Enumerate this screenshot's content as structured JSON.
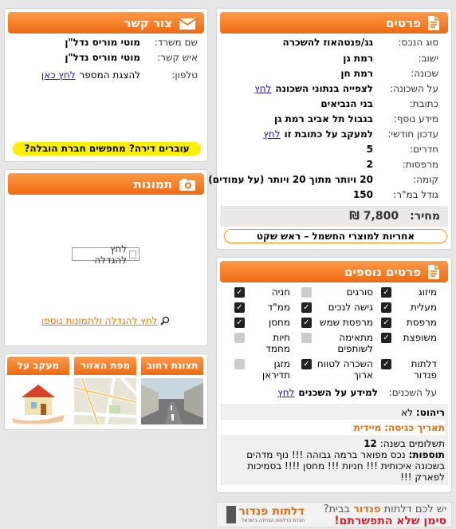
{
  "details": {
    "title": "פרטים",
    "rows": [
      {
        "label": "סוג הנכס:",
        "value": "גג/פנטהאוז להשכרה"
      },
      {
        "label": "ישוב:",
        "value": "רמת גן"
      },
      {
        "label": "שכונה:",
        "value": "רמת חן"
      },
      {
        "label": "על השכונה:",
        "value": "לצפייה בנתוני השכונה",
        "link": "לחץ"
      },
      {
        "label": "כתובת:",
        "value": "בני הנביאים"
      },
      {
        "label": "מידע נוסף:",
        "value": "בגבול תל אביב רמת גן"
      },
      {
        "label": "עדכון חודשי:",
        "value": "למעקב על כתובת זו",
        "link": "לחץ"
      },
      {
        "label": "חדרים:",
        "value": "5"
      },
      {
        "label": "מרפסות:",
        "value": "2"
      },
      {
        "label": "קומה:",
        "value": "20 ויותר מתוך 20 ויותר (על עמודים)"
      },
      {
        "label": "גודל במ\"ר:",
        "value": "150"
      }
    ],
    "price_label": "מחיר:",
    "price_value": "7,800 ₪",
    "warranty": "אחריות למוצרי החשמל – ראש שקט"
  },
  "contact": {
    "title": "צור קשר",
    "advertiser_label": "שם משרד:",
    "advertiser_value": "מוטי מוריס נדל\"ן",
    "agent_label": "איש קשר:",
    "agent_value": "מוטי מוריס נדל\"ן",
    "phone_label": "טלפון:",
    "phone_text": "להצגת המספר",
    "phone_link": "לחץ כאן",
    "moving_banner": "עוברים דירה? מחפשים חברת הובלה?"
  },
  "photos": {
    "title": "תמונות",
    "placeholder_alt": "לחץ להגדלה",
    "more_link": "לחץ להגדלה ולתמונות נוספו"
  },
  "thumbs": [
    {
      "caption": "תצוגת רחוב"
    },
    {
      "caption": "מפת האזור"
    },
    {
      "caption": "מעקב על הנכס"
    }
  ],
  "extra": {
    "title": "פרטים נוספים",
    "features": [
      {
        "label": "מיזוג",
        "checked": true
      },
      {
        "label": "סורגים",
        "checked": false
      },
      {
        "label": "חניה",
        "checked": true
      },
      {
        "label": "מעלית",
        "checked": true
      },
      {
        "label": "גישה לנכים",
        "checked": true
      },
      {
        "label": "ממ\"ד",
        "checked": true
      },
      {
        "label": "מרפסת",
        "checked": true
      },
      {
        "label": "מרפסת שמש",
        "checked": true
      },
      {
        "label": "מחסן",
        "checked": true
      },
      {
        "label": "משופצת",
        "checked": true
      },
      {
        "label": "מתאימה לשותפים",
        "checked": false
      },
      {
        "label": "חיות מחמד",
        "checked": false
      },
      {
        "label": "דלתות פנדור",
        "checked": true
      },
      {
        "label": "השכרה לטווח ארוך",
        "checked": true
      },
      {
        "label": "מזגן תדיראן",
        "checked": false
      }
    ],
    "neighbors_label": "על השכנים:",
    "neighbors_text": "למידע על השכנים",
    "neighbors_link": "לחץ",
    "furniture_label": "ריהוט:",
    "furniture_value": "לא",
    "entry_label": "תאריך כניסה:",
    "entry_value": "מיידית",
    "payments_label": "תשלומים בשנה:",
    "payments_value": "12",
    "notes_label": "תוספות:",
    "notes_value": "נכס מפואר ברמה גבוהה !!! נוף מדהים בשכונה איכותית !!! חניות !!! מחסן !!!! בסמיכות לפארק !!!"
  },
  "ad": {
    "line1": "יש לכם דלתות",
    "brand": "פנדור",
    "line1b": "בבית?",
    "line2": "סימן שלא התפשרתם!",
    "logo": "דלתות פנדור",
    "tagline": "חברת הדלתות הגדולה בישראל"
  }
}
